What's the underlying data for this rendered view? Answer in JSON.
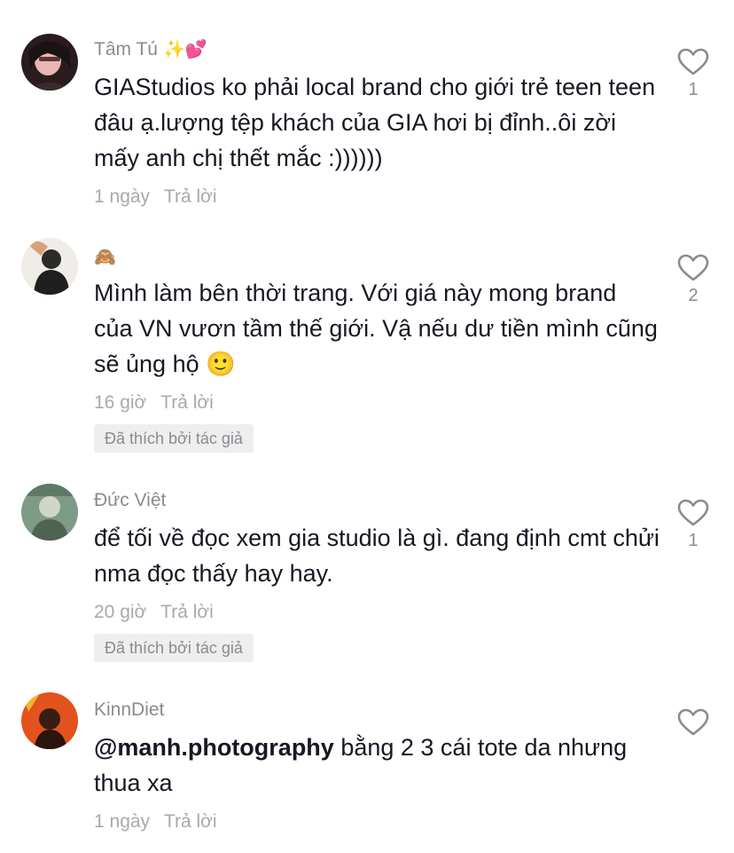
{
  "comments": [
    {
      "username": "Tâm Tú",
      "username_emoji": "✨💕",
      "text": "GIAStudios ko phải local brand cho giới trẻ teen teen đâu ạ.lượng tệp khách của GIA hơi bị đỉnh..ôi zời mấy anh chị thết mắc :))))))",
      "time": "1 ngày",
      "reply_label": "Trả lời",
      "likes": "1",
      "author_liked": ""
    },
    {
      "username": "",
      "username_emoji": "🙈",
      "text": "Mình làm bên thời trang. Với giá này mong brand của VN vươn tầm thế giới. Vậ nếu dư tiền mình cũng sẽ ủng hộ 🙂",
      "time": "16 giờ",
      "reply_label": "Trả lời",
      "likes": "2",
      "author_liked": "Đã thích bởi tác giả"
    },
    {
      "username": "Đức Việt",
      "username_emoji": "",
      "text": "để tối về đọc xem gia studio là gì. đang định cmt chửi nma đọc thấy hay hay.",
      "time": "20 giờ",
      "reply_label": "Trả lời",
      "likes": "1",
      "author_liked": "Đã thích bởi tác giả"
    },
    {
      "username": "KinnDiet",
      "username_emoji": "",
      "mention": "@manh.photography",
      "text": " bằng 2 3 cái tote da nhưng thua xa",
      "time": "1 ngày",
      "reply_label": "Trả lời",
      "likes": "",
      "author_liked": ""
    }
  ],
  "colors": {
    "text": "#161823",
    "muted": "#8a8b91",
    "badge_bg": "#eeeeef"
  },
  "icons": {
    "like": "heart-outline-icon"
  }
}
